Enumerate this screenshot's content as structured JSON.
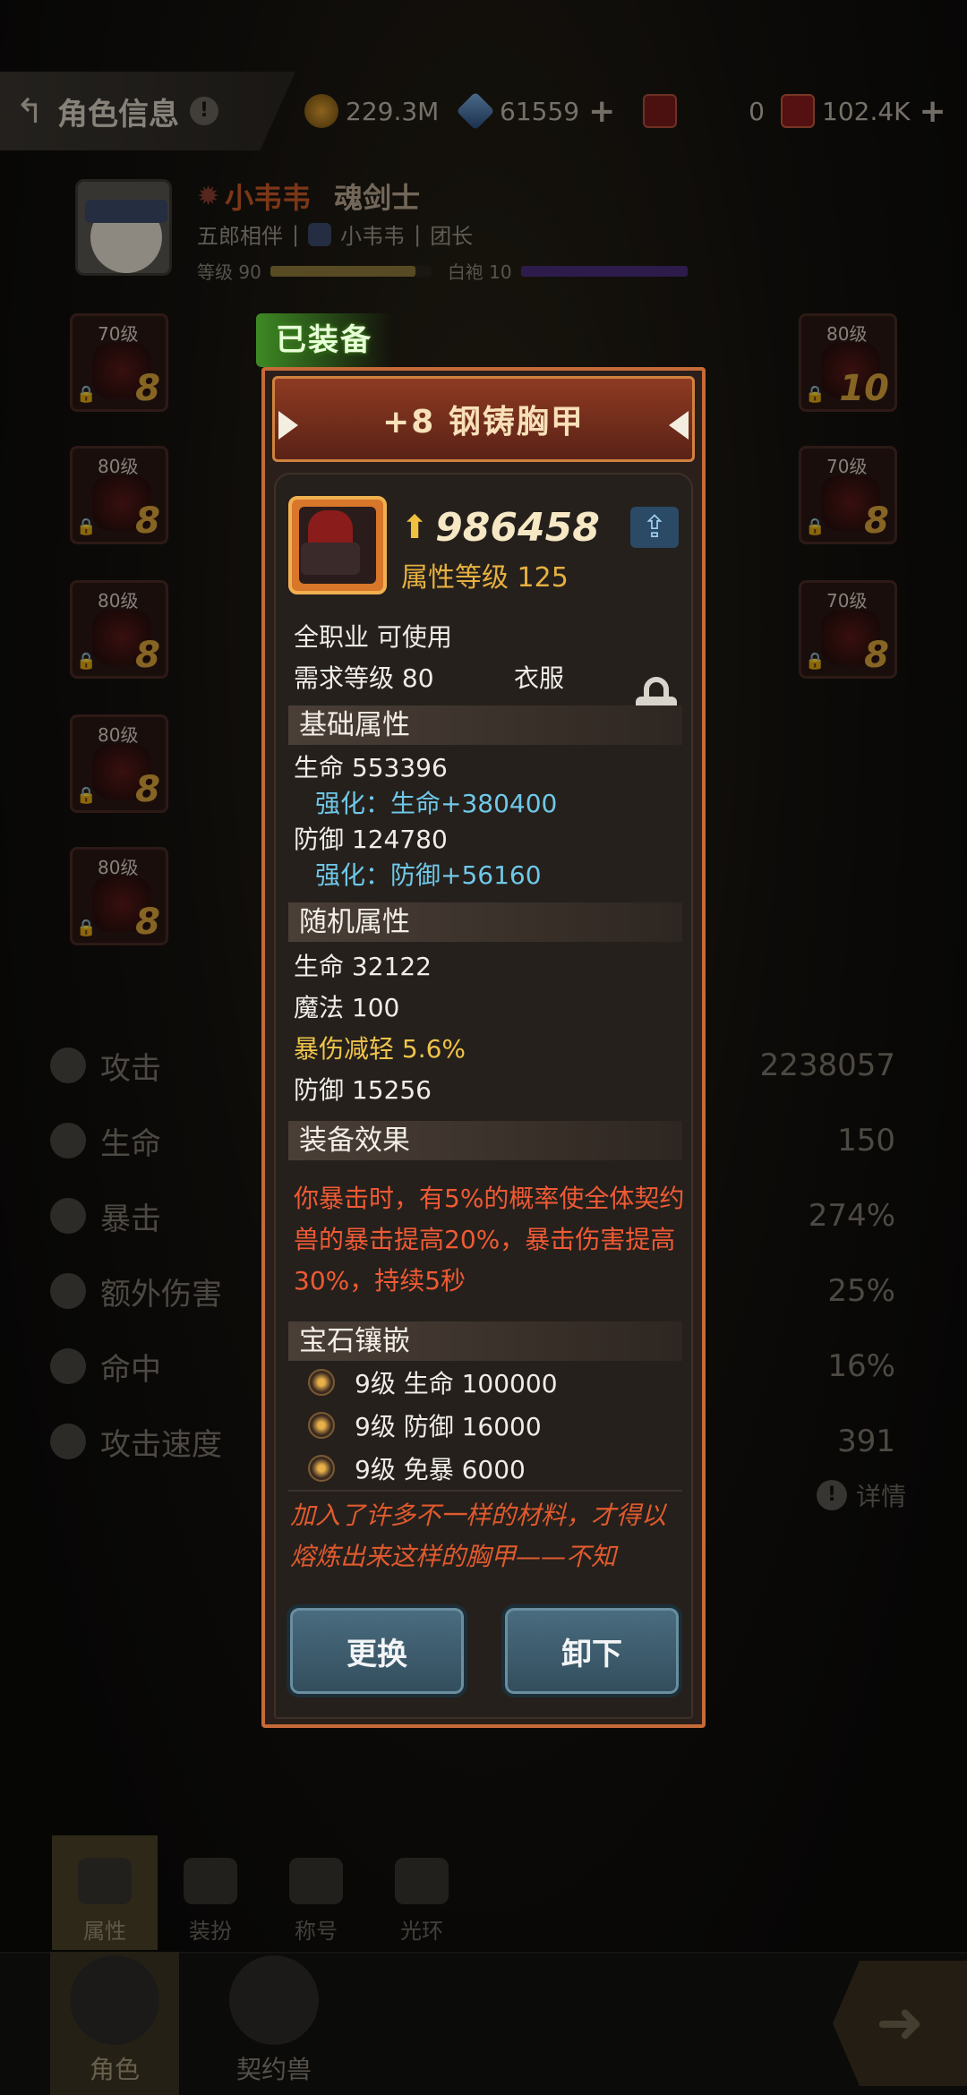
{
  "topbar": {
    "title": "角色信息",
    "help": "!",
    "gold": "229.3M",
    "crystal": "61559",
    "ticket": "0",
    "card": "102.4K"
  },
  "hero": {
    "name": "小韦韦",
    "class": "魂剑士",
    "partner": "五郎相伴",
    "guild_member": "小韦韦",
    "guild_role": "团长",
    "level_label": "等级 90",
    "rank_label": "白袍 10",
    "level_progress": 0.9,
    "rank_progress": 1.0
  },
  "slots": [
    {
      "level": "70级",
      "plus": "8"
    },
    {
      "level": "80级",
      "plus": "8"
    },
    {
      "level": "80级",
      "plus": "8"
    },
    {
      "level": "80级",
      "plus": "8"
    },
    {
      "level": "80级",
      "plus": "8"
    },
    {
      "level": "80级",
      "plus": "10"
    },
    {
      "level": "70级",
      "plus": "8"
    },
    {
      "level": "70级",
      "plus": "8"
    }
  ],
  "stats": [
    {
      "name": "攻击",
      "value": "2238057"
    },
    {
      "name": "生命",
      "value": "150"
    },
    {
      "name": "暴击",
      "value": "274%"
    },
    {
      "name": "额外伤害",
      "value": "25%"
    },
    {
      "name": "命中",
      "value": "16%"
    },
    {
      "name": "攻击速度",
      "value": "391"
    }
  ],
  "detail_label": "详情",
  "equipped_tag": "已装备",
  "item": {
    "title": "+8 钢铸胸甲",
    "power": "986458",
    "attr_level": "属性等级 125",
    "usable": "全职业 可使用",
    "req_level": "需求等级 80",
    "slot_type": "衣服",
    "base_header": "基础属性",
    "base_hp": "生命  553396",
    "base_hp_enh": "强化：生命+380400",
    "base_def": "防御  124780",
    "base_def_enh": "强化：防御+56160",
    "random_header": "随机属性",
    "random": [
      {
        "text": "生命   32122",
        "gold": false
      },
      {
        "text": "魔法   100",
        "gold": false
      },
      {
        "text": "暴伤减轻   5.6%",
        "gold": true
      },
      {
        "text": "防御   15256",
        "gold": false
      }
    ],
    "effect_header": "装备效果",
    "effect_text": "你暴击时，有5%的概率使全体契约兽的暴击提高20%，暴击伤害提高30%，持续5秒",
    "gem_header": "宝石镶嵌",
    "gems": [
      {
        "text": "9级   生命 100000"
      },
      {
        "text": "9级   防御 16000"
      },
      {
        "text": "9级   免暴 6000"
      }
    ],
    "flavor": "加入了许多不一样的材料，才得以熔炼出来这样的胸甲——不知",
    "replace_label": "更换",
    "unequip_label": "卸下"
  },
  "subtabs": [
    "属性",
    "装扮",
    "称号",
    "光环"
  ],
  "nav": [
    "角色",
    "契约兽"
  ]
}
